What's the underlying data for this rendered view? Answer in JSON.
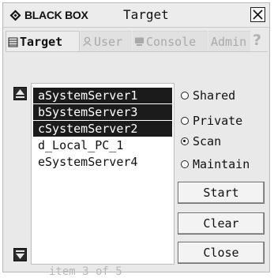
{
  "window": {
    "brand": "BLACK BOX",
    "title": "Target"
  },
  "tabs": [
    {
      "label": "Target",
      "icon": "target-tab-icon",
      "active": true
    },
    {
      "label": "User",
      "icon": "user-tab-icon",
      "active": false
    },
    {
      "label": "Console",
      "icon": "console-tab-icon",
      "active": false
    },
    {
      "label": "Admin",
      "icon": "",
      "active": false
    }
  ],
  "help_label": "?",
  "targets": [
    {
      "name": "aSystemServer1",
      "selected": true
    },
    {
      "name": "bSystemServer3",
      "selected": true
    },
    {
      "name": "cSystemServer2",
      "selected": true
    },
    {
      "name": "d_Local_PC_1",
      "selected": false
    },
    {
      "name": "eSystemServer4",
      "selected": false
    }
  ],
  "list_status": "item 3 of 5",
  "modes": [
    {
      "label": "Shared",
      "checked": false
    },
    {
      "label": "Private",
      "checked": false
    },
    {
      "label": "Scan",
      "checked": true
    },
    {
      "label": "Maintain",
      "checked": false
    }
  ],
  "buttons": {
    "start": "Start",
    "clear": "Clear",
    "close": "Close"
  },
  "colors": {
    "window_bg": "#e9e9e9",
    "selection_bg": "#1b1b1b",
    "disabled_text": "#a9a9a9"
  }
}
